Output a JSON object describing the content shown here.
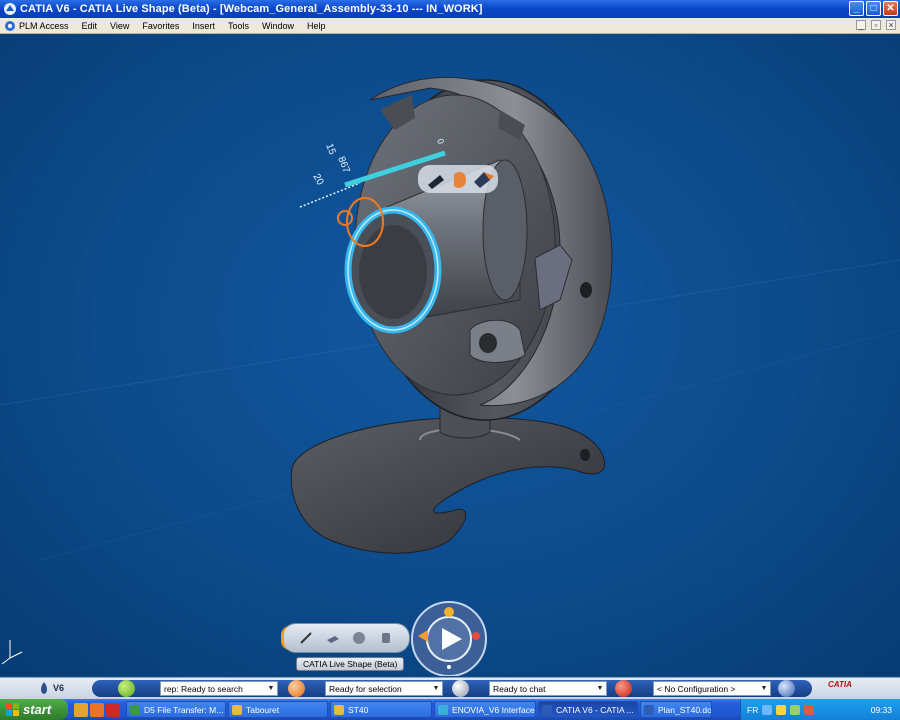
{
  "window": {
    "title": "CATIA V6 - CATIA Live Shape (Beta) - [Webcam_General_Assembly-33-10 --- IN_WORK]"
  },
  "menu": [
    "PLM Access",
    "Edit",
    "View",
    "Favorites",
    "Insert",
    "Tools",
    "Window",
    "Help"
  ],
  "viewport": {
    "dial_values": [
      "15",
      "867",
      "20",
      "0"
    ]
  },
  "dock": {
    "label": "CATIA Live Shape (Beta)"
  },
  "status": {
    "logo": "V6",
    "search": "rep: Ready to search",
    "selection": "Ready for selection",
    "chat": "Ready to chat",
    "configuration": "< No Configuration >",
    "brand": "CATIA"
  },
  "taskbar": {
    "start": "start",
    "tasks": [
      "D5 File Transfer: M...",
      "Tabouret",
      "ST40",
      "ENOVIA_V6 Interface",
      "CATIA V6 - CATIA ...",
      "Plan_ST40.doc - Mi..."
    ],
    "lang": "FR",
    "clock": "09:33"
  },
  "colors": {
    "titlebar": "#0a46c8",
    "viewport": "#0c4b8c",
    "accent": "#f39a1e",
    "highlight": "#35b8f0",
    "taskbar": "#245edb",
    "start": "#3a8e36"
  }
}
